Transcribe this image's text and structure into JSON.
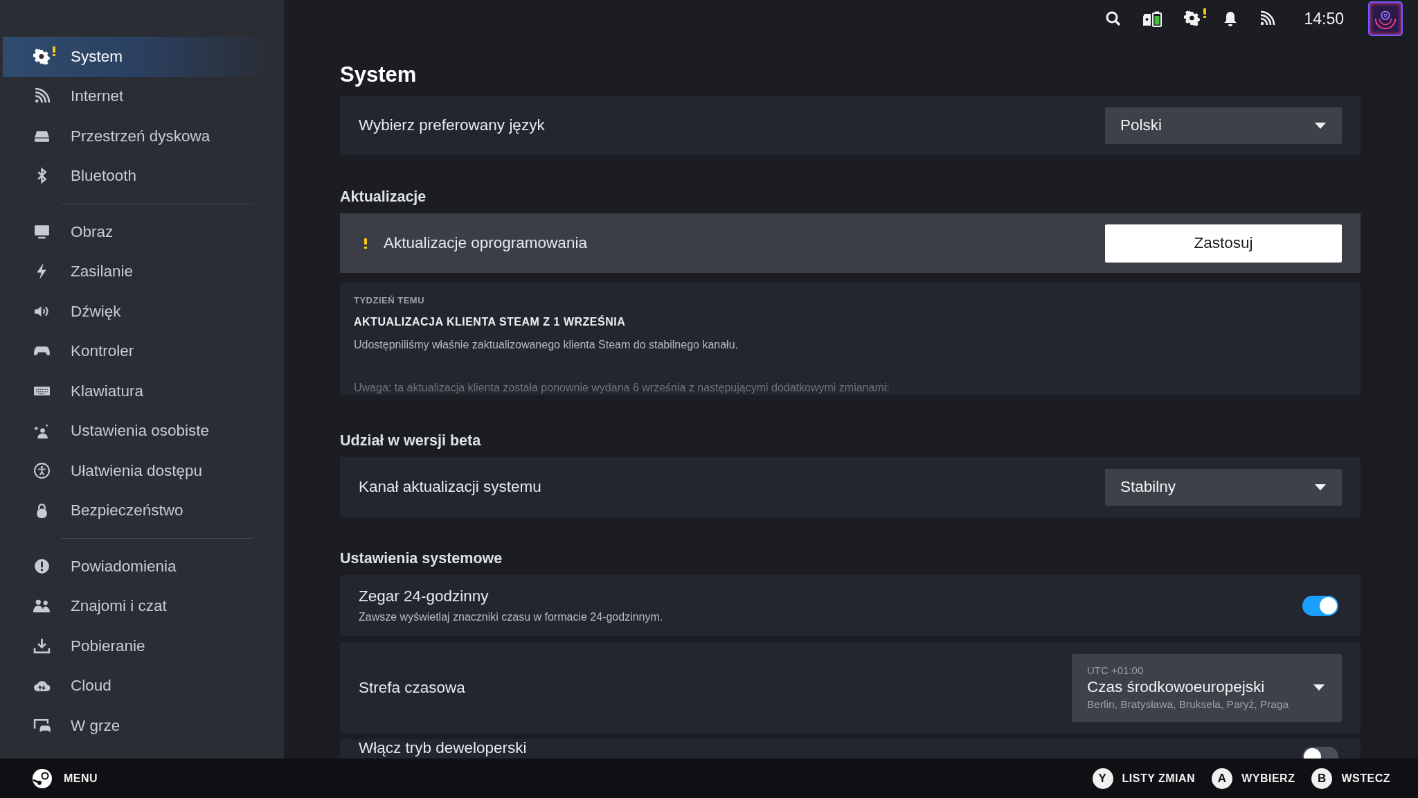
{
  "status_bar": {
    "settings_alert": true,
    "time": "14:50"
  },
  "sidebar": {
    "groups": [
      {
        "items": [
          {
            "label": "System",
            "selected": true,
            "alert": true
          },
          {
            "label": "Internet",
            "selected": false,
            "alert": false
          },
          {
            "label": "Przestrzeń dyskowa",
            "selected": false,
            "alert": false
          },
          {
            "label": "Bluetooth",
            "selected": false,
            "alert": false
          }
        ]
      },
      {
        "items": [
          {
            "label": "Obraz",
            "selected": false,
            "alert": false
          },
          {
            "label": "Zasilanie",
            "selected": false,
            "alert": false
          },
          {
            "label": "Dźwięk",
            "selected": false,
            "alert": false
          },
          {
            "label": "Kontroler",
            "selected": false,
            "alert": false
          },
          {
            "label": "Klawiatura",
            "selected": false,
            "alert": false
          },
          {
            "label": "Ustawienia osobiste",
            "selected": false,
            "alert": false
          },
          {
            "label": "Ułatwienia dostępu",
            "selected": false,
            "alert": false
          },
          {
            "label": "Bezpieczeństwo",
            "selected": false,
            "alert": false
          }
        ]
      },
      {
        "items": [
          {
            "label": "Powiadomienia",
            "selected": false,
            "alert": false
          },
          {
            "label": "Znajomi i czat",
            "selected": false,
            "alert": false
          },
          {
            "label": "Pobieranie",
            "selected": false,
            "alert": false
          },
          {
            "label": "Cloud",
            "selected": false,
            "alert": false
          },
          {
            "label": "W grze",
            "selected": false,
            "alert": false
          }
        ]
      }
    ]
  },
  "title": "System",
  "sections": [
    {
      "rows": [
        {
          "kind": "dropdown",
          "label": "Wybierz preferowany język",
          "value": "Polski"
        }
      ]
    },
    {
      "heading": "Aktualizacje",
      "rows": [
        {
          "kind": "button",
          "label": "Aktualizacje oprogramowania",
          "alert": true,
          "button": "Zastosuj"
        },
        {
          "kind": "news",
          "age": "TYDZIEŃ TEMU",
          "headline": "AKTUALIZACJA KLIENTA STEAM Z 1 WRZEŚNIA",
          "paragraphs": [
            "Udostępniliśmy właśnie zaktualizowanego klienta Steam do stabilnego kanału.",
            "Uwaga: ta aktualizacja klienta została ponownie wydana 6 września z następującymi dodatkowymi zmianami:"
          ]
        }
      ]
    },
    {
      "heading": "Udział w wersji beta",
      "rows": [
        {
          "kind": "dropdown",
          "label": "Kanał aktualizacji systemu",
          "value": "Stabilny"
        }
      ]
    },
    {
      "heading": "Ustawienia systemowe",
      "rows": [
        {
          "kind": "toggle",
          "label": "Zegar 24-godzinny",
          "description": "Zawsze wyświetlaj znaczniki czasu w formacie 24-godzinnym.",
          "on": true
        },
        {
          "kind": "timezone",
          "label": "Strefa czasowa",
          "offset": "UTC +01:00",
          "value": "Czas środkowoeuropejski",
          "cities": "Berlin, Bratysława, Bruksela, Paryż, Praga"
        },
        {
          "kind": "toggle",
          "label": "Włącz tryb deweloperski",
          "on": false
        }
      ]
    }
  ],
  "footer": {
    "menu": "MENU",
    "hints": [
      {
        "key": "Y",
        "label": "LISTY ZMIAN"
      },
      {
        "key": "A",
        "label": "WYBIERZ"
      },
      {
        "key": "B",
        "label": "WSTECZ"
      }
    ]
  }
}
